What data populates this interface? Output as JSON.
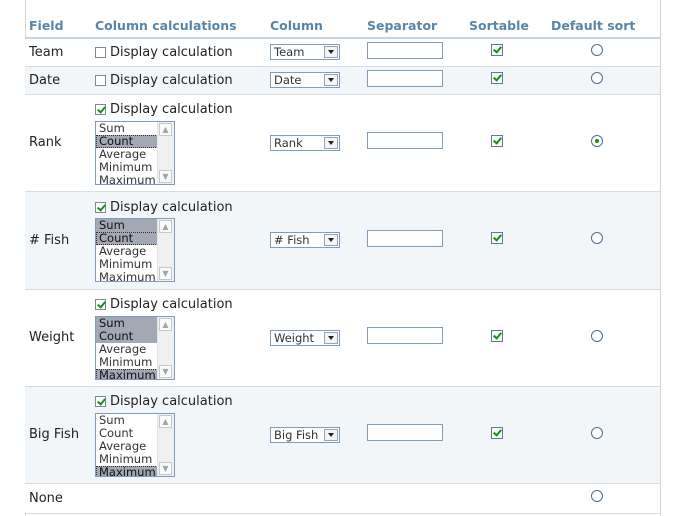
{
  "headers": {
    "field": "Field",
    "calc": "Column calculations",
    "column": "Column",
    "separator": "Separator",
    "sortable": "Sortable",
    "default_sort": "Default sort"
  },
  "display_calc_label": "Display calculation",
  "calc_options": [
    "Sum",
    "Count",
    "Average",
    "Minimum",
    "Maximum"
  ],
  "rows": [
    {
      "field": "Team",
      "display_calc": false,
      "column": "Team",
      "sortable": true,
      "default_sort": false
    },
    {
      "field": "Date",
      "display_calc": false,
      "column": "Date",
      "sortable": true,
      "default_sort": false
    },
    {
      "field": "Rank",
      "display_calc": true,
      "selected": [
        "Count"
      ],
      "focused": "Count",
      "column": "Rank",
      "sortable": true,
      "default_sort": true
    },
    {
      "field": "# Fish",
      "display_calc": true,
      "selected": [
        "Sum",
        "Count"
      ],
      "focused": "Count",
      "column": "# Fish",
      "sortable": true,
      "default_sort": false
    },
    {
      "field": "Weight",
      "display_calc": true,
      "selected": [
        "Sum",
        "Count",
        "Maximum"
      ],
      "focused": "Maximum",
      "column": "Weight",
      "sortable": true,
      "default_sort": false
    },
    {
      "field": "Big Fish",
      "display_calc": true,
      "selected": [
        "Maximum"
      ],
      "focused": "Maximum",
      "column": "Big Fish",
      "sortable": true,
      "default_sort": false
    },
    {
      "field": "None",
      "default_sort": false
    }
  ]
}
